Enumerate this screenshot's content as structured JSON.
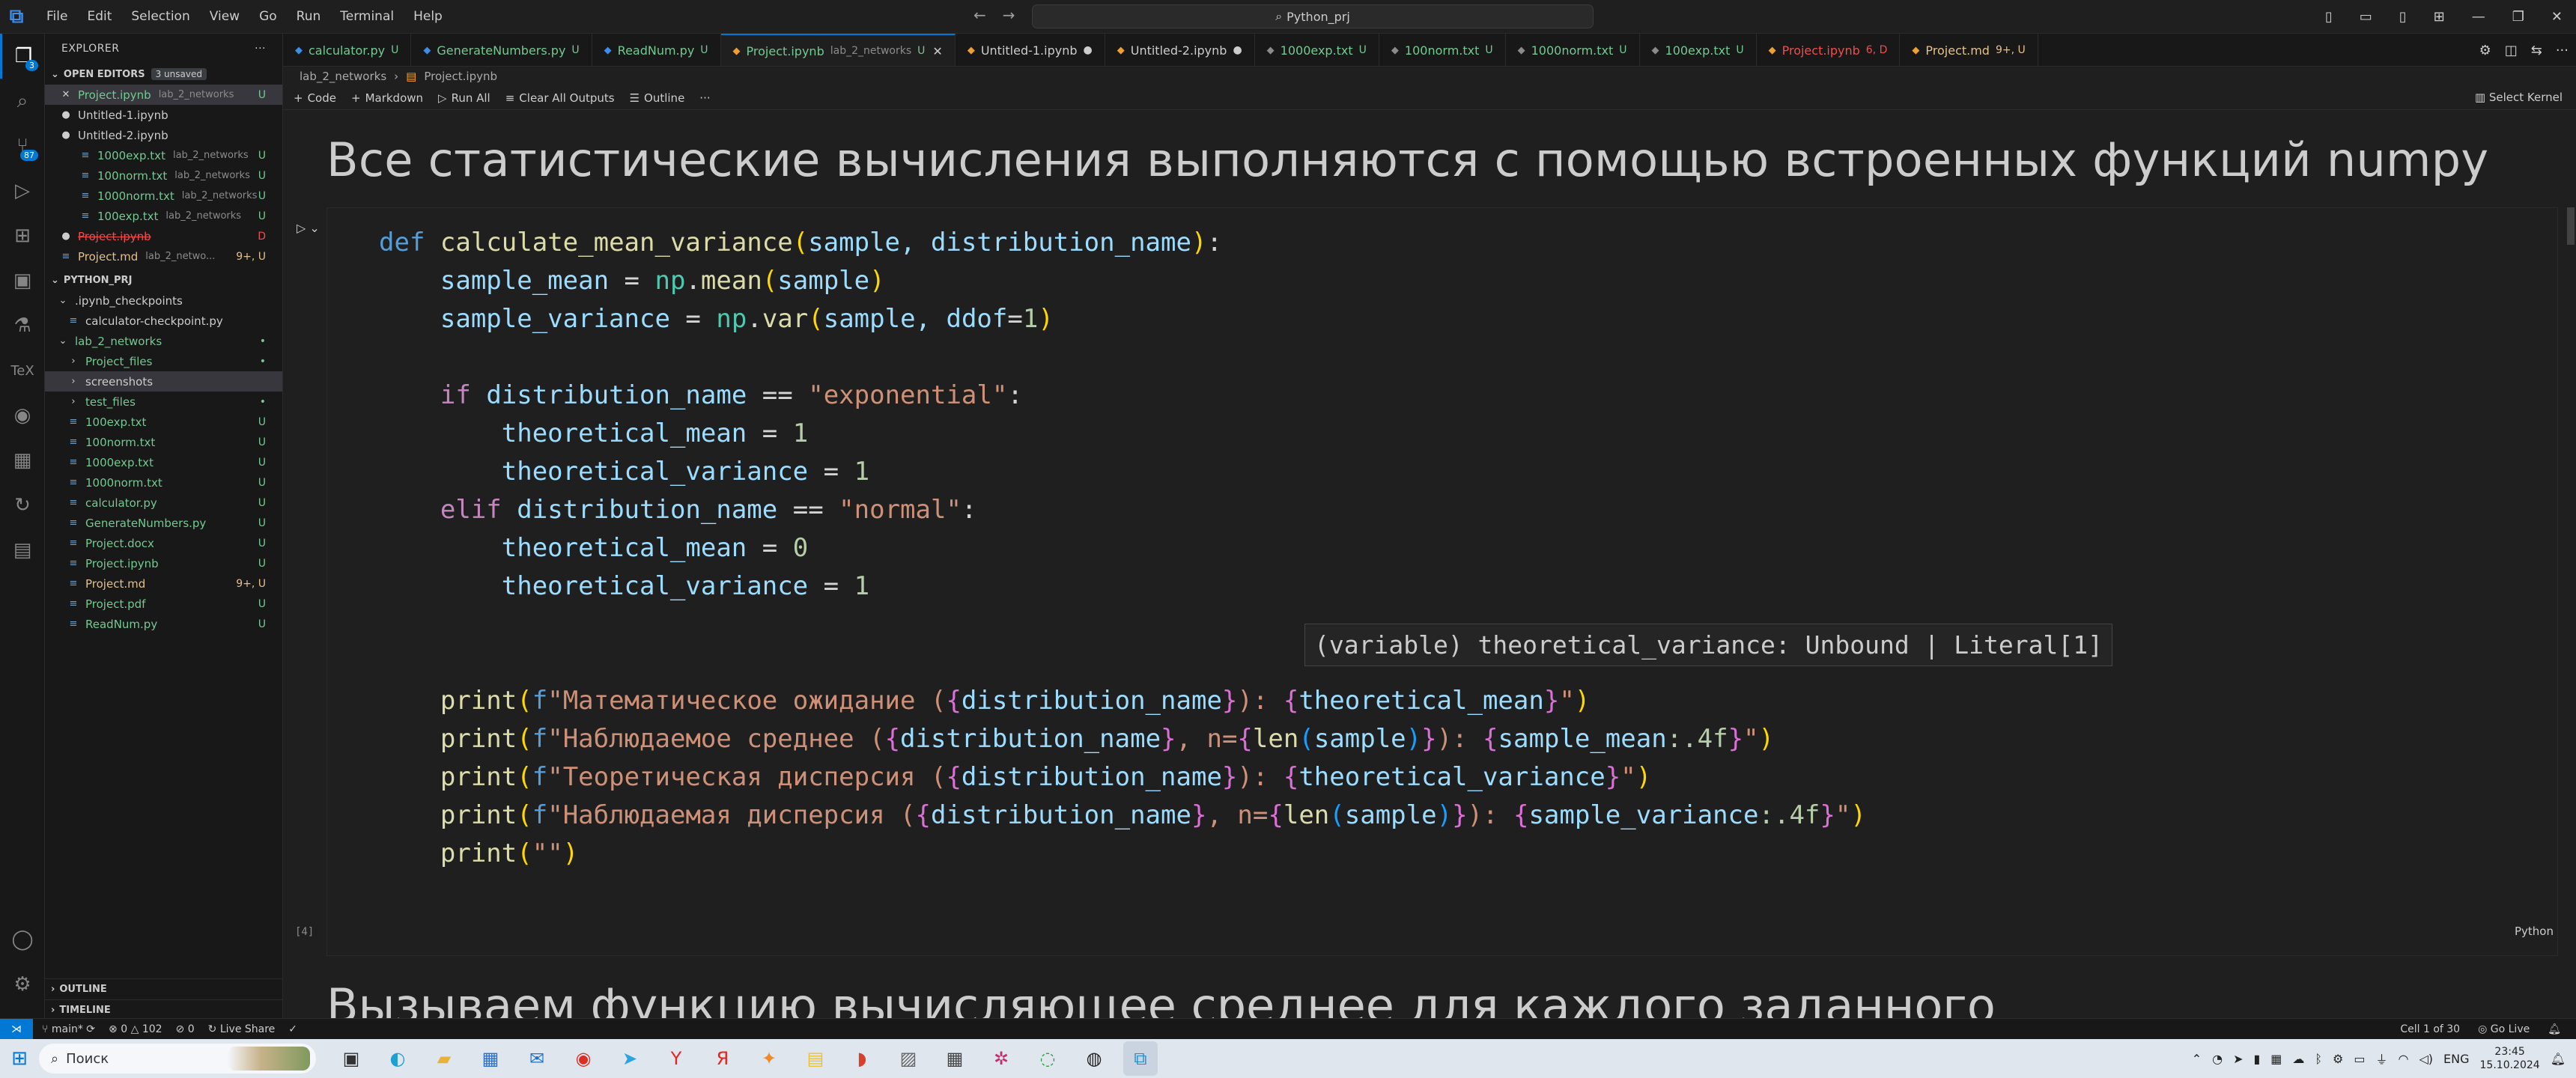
{
  "menu": [
    "File",
    "Edit",
    "Selection",
    "View",
    "Go",
    "Run",
    "Terminal",
    "Help"
  ],
  "search": {
    "text": "Python_prj"
  },
  "explorer": {
    "title": "EXPLORER",
    "open_editors": {
      "label": "OPEN EDITORS",
      "count": "3 unsaved"
    },
    "open_items": [
      {
        "name": "Project.ipynb",
        "path": "lab_2_networks",
        "status": "U",
        "color": "#73c991",
        "dirty": false,
        "close": true
      },
      {
        "name": "Untitled-1.ipynb",
        "path": "",
        "status": "",
        "color": "#cccccc",
        "dirty": true,
        "close": false
      },
      {
        "name": "Untitled-2.ipynb",
        "path": "",
        "status": "",
        "color": "#cccccc",
        "dirty": true,
        "close": false
      },
      {
        "name": "1000exp.txt",
        "path": "lab_2_networks",
        "status": "U",
        "color": "#73c991",
        "dirty": false,
        "close": false
      },
      {
        "name": "100norm.txt",
        "path": "lab_2_networks",
        "status": "U",
        "color": "#73c991",
        "dirty": false,
        "close": false
      },
      {
        "name": "1000norm.txt",
        "path": "lab_2_networks",
        "status": "U",
        "color": "#73c991",
        "dirty": false,
        "close": false
      },
      {
        "name": "100exp.txt",
        "path": "lab_2_networks",
        "status": "U",
        "color": "#73c991",
        "dirty": false,
        "close": false
      },
      {
        "name": "Project.ipynb",
        "path": "",
        "status": "D",
        "color": "#f14c4c",
        "dirty": true,
        "close": false
      },
      {
        "name": "Project.md",
        "path": "lab_2_netwo...",
        "status": "9+, U",
        "color": "#e2c08d",
        "dirty": false,
        "close": false
      }
    ],
    "project": {
      "label": "PYTHON_PRJ"
    },
    "tree": [
      {
        "name": ".ipynb_checkpoints",
        "indent": 1,
        "folder": true,
        "open": true,
        "color": "#cccccc",
        "status": ""
      },
      {
        "name": "calculator-checkpoint.py",
        "indent": 2,
        "folder": false,
        "color": "#cccccc",
        "status": ""
      },
      {
        "name": "lab_2_networks",
        "indent": 1,
        "folder": true,
        "open": true,
        "color": "#73c991",
        "status": "•"
      },
      {
        "name": "Project_files",
        "indent": 2,
        "folder": true,
        "open": false,
        "color": "#73c991",
        "status": "•"
      },
      {
        "name": "screenshots",
        "indent": 2,
        "folder": true,
        "open": false,
        "color": "#cccccc",
        "status": "",
        "sel": true
      },
      {
        "name": "test_files",
        "indent": 2,
        "folder": true,
        "open": false,
        "color": "#73c991",
        "status": "•"
      },
      {
        "name": "100exp.txt",
        "indent": 2,
        "folder": false,
        "color": "#73c991",
        "status": "U"
      },
      {
        "name": "100norm.txt",
        "indent": 2,
        "folder": false,
        "color": "#73c991",
        "status": "U"
      },
      {
        "name": "1000exp.txt",
        "indent": 2,
        "folder": false,
        "color": "#73c991",
        "status": "U"
      },
      {
        "name": "1000norm.txt",
        "indent": 2,
        "folder": false,
        "color": "#73c991",
        "status": "U"
      },
      {
        "name": "calculator.py",
        "indent": 2,
        "folder": false,
        "color": "#73c991",
        "status": "U"
      },
      {
        "name": "GenerateNumbers.py",
        "indent": 2,
        "folder": false,
        "color": "#73c991",
        "status": "U"
      },
      {
        "name": "Project.docx",
        "indent": 2,
        "folder": false,
        "color": "#73c991",
        "status": "U"
      },
      {
        "name": "Project.ipynb",
        "indent": 2,
        "folder": false,
        "color": "#73c991",
        "status": "U"
      },
      {
        "name": "Project.md",
        "indent": 2,
        "folder": false,
        "color": "#e2c08d",
        "status": "9+, U"
      },
      {
        "name": "Project.pdf",
        "indent": 2,
        "folder": false,
        "color": "#73c991",
        "status": "U"
      },
      {
        "name": "ReadNum.py",
        "indent": 2,
        "folder": false,
        "color": "#73c991",
        "status": "U"
      }
    ],
    "outline": "OUTLINE",
    "timeline": "TIMELINE"
  },
  "tabs": [
    {
      "name": "calculator.py",
      "path": "",
      "status": "U",
      "color": "#73c991",
      "active": false
    },
    {
      "name": "GenerateNumbers.py",
      "path": "",
      "status": "U",
      "color": "#73c991",
      "active": false
    },
    {
      "name": "ReadNum.py",
      "path": "",
      "status": "U",
      "color": "#73c991",
      "active": false
    },
    {
      "name": "Project.ipynb",
      "path": "lab_2_networks",
      "status": "U",
      "color": "#73c991",
      "active": true
    },
    {
      "name": "Untitled-1.ipynb",
      "path": "",
      "status": "●",
      "color": "#cccccc",
      "active": false
    },
    {
      "name": "Untitled-2.ipynb",
      "path": "",
      "status": "●",
      "color": "#cccccc",
      "active": false
    },
    {
      "name": "1000exp.txt",
      "path": "",
      "status": "U",
      "color": "#73c991",
      "active": false
    },
    {
      "name": "100norm.txt",
      "path": "",
      "status": "U",
      "color": "#73c991",
      "active": false
    },
    {
      "name": "1000norm.txt",
      "path": "",
      "status": "U",
      "color": "#73c991",
      "active": false
    },
    {
      "name": "100exp.txt",
      "path": "",
      "status": "U",
      "color": "#73c991",
      "active": false
    },
    {
      "name": "Project.ipynb",
      "path": "",
      "status": "6, D",
      "color": "#f14c4c",
      "active": false
    },
    {
      "name": "Project.md",
      "path": "",
      "status": "9+, U",
      "color": "#e2c08d",
      "active": false
    }
  ],
  "breadcrumb": {
    "folder": "lab_2_networks",
    "file": "Project.ipynb"
  },
  "notebook_toolbar": {
    "code": "Code",
    "markdown": "Markdown",
    "run_all": "Run All",
    "clear": "Clear All Outputs",
    "outline": "Outline",
    "kernel": "Select Kernel"
  },
  "markdown_top": "Все статистические вычисления выполняются с помощью встроенных функций numpy",
  "markdown_bottom": "Вызываем функцию вычисляющее среднее для каждого заданного",
  "hover_text": "(variable) theoretical_variance: Unbound | Literal[1]",
  "exec_count": "[4]",
  "cell_language": "Python",
  "statusbar": {
    "branch": "main*",
    "errors": "0",
    "warnings": "102",
    "ports": "0",
    "liveshare": "Live Share",
    "cell_pos": "Cell 1 of 30",
    "golive": "Go Live"
  },
  "taskbar": {
    "search": "Поиск",
    "lang": "ENG",
    "time": "23:45",
    "date": "15.10.2024"
  }
}
